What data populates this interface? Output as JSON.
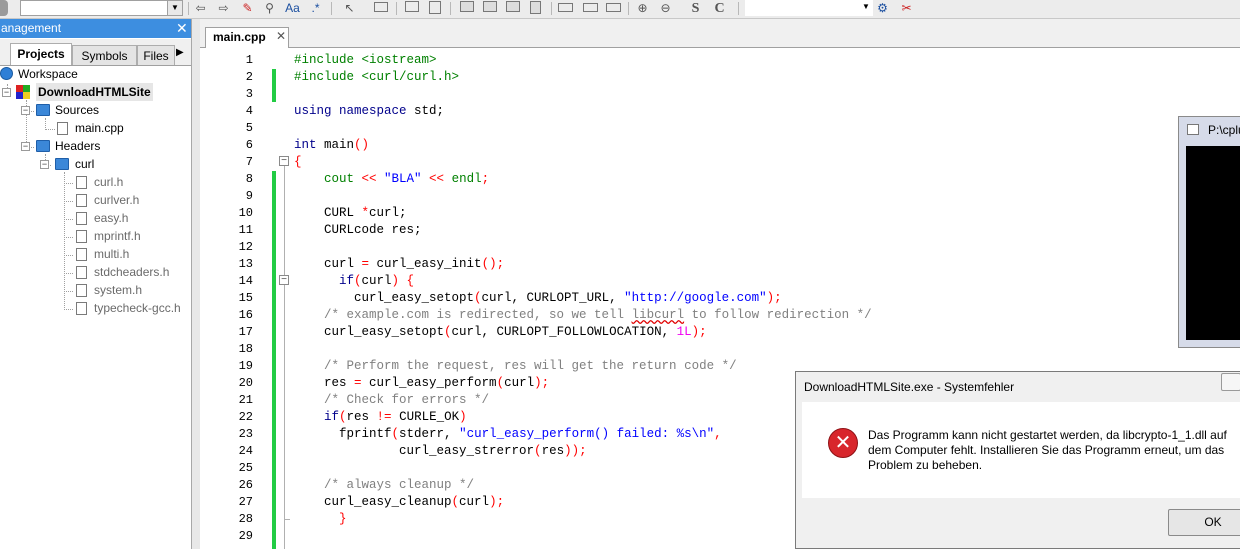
{
  "toolbar": {
    "icons": [
      "nav-back-icon",
      "nav-forward-icon",
      "highlight-icon",
      "bookmark-icon",
      "font-icon",
      "regex-icon",
      "select-icon",
      "frame-icon",
      "envelope-icon",
      "document-icon",
      "layout-icon",
      "zoom-in-icon",
      "zoom-out-icon",
      "spell-icon",
      "refresh-icon",
      "build-settings-icon",
      "tools-icon"
    ],
    "glyphs": {
      "back": "⇦",
      "forward": "⇨",
      "highlight": "✎",
      "bookmark": "⚲",
      "font": "Aa",
      "regex": ".*",
      "select": "↖",
      "zoomin": "⊕",
      "zoomout": "⊖",
      "s": "S",
      "c": "C",
      "settings": "⚙",
      "tools": "✂"
    }
  },
  "management": {
    "title": "anagement",
    "close": "✕",
    "tabs": [
      {
        "label": "Projects",
        "active": true
      },
      {
        "label": "Symbols",
        "active": false
      },
      {
        "label": "Files",
        "active": false
      }
    ],
    "tab_arrow": "▶",
    "tree": {
      "workspace": "Workspace",
      "project": "DownloadHTMLSite",
      "sources": "Sources",
      "main_file": "main.cpp",
      "headers": "Headers",
      "curl_folder": "curl",
      "headers_files": [
        "curl.h",
        "curlver.h",
        "easy.h",
        "mprintf.h",
        "multi.h",
        "stdcheaders.h",
        "system.h",
        "typecheck-gcc.h"
      ]
    }
  },
  "editor": {
    "tab_label": "main.cpp",
    "tab_close": "✕",
    "line_numbers": [
      "1",
      "2",
      "3",
      "4",
      "5",
      "6",
      "7",
      "8",
      "9",
      "10",
      "11",
      "12",
      "13",
      "14",
      "15",
      "16",
      "17",
      "18",
      "19",
      "20",
      "21",
      "22",
      "23",
      "24",
      "25",
      "26",
      "27",
      "28",
      "29"
    ],
    "code": {
      "l1": "#include <iostream>",
      "l2": "#include <curl/curl.h>",
      "l4a": "using namespace",
      "l4b": " std;",
      "l6a": "int",
      "l6b": " main",
      "l6c": "()",
      "l7": "{",
      "l8a": "    cout",
      "l8b": " << ",
      "l8c": "\"BLA\"",
      "l8d": " << ",
      "l8e": "endl",
      "l8f": ";",
      "l10a": "    CURL ",
      "l10b": "*",
      "l10c": "curl;",
      "l11": "    CURLcode res;",
      "l13a": "    curl ",
      "l13b": "=",
      "l13c": " curl_easy_init",
      "l13d": "();",
      "l14a": "      if",
      "l14b": "(",
      "l14c": "curl",
      "l14d": ") {",
      "l15a": "        curl_easy_setopt",
      "l15b": "(",
      "l15c": "curl, CURLOPT_URL, ",
      "l15d": "\"http://google.com\"",
      "l15e": ");",
      "l16a": "    /* example.com is redirected, so we tell ",
      "l16b": "libcurl",
      "l16c": " to follow redirection */",
      "l17a": "    curl_easy_setopt",
      "l17b": "(",
      "l17c": "curl, CURLOPT_FOLLOWLOCATION, ",
      "l17d": "1L",
      "l17e": ");",
      "l19": "    /* Perform the request, res will get the return code */",
      "l20a": "    res ",
      "l20b": "=",
      "l20c": " curl_easy_perform",
      "l20d": "(",
      "l20e": "curl",
      "l20f": ");",
      "l21": "    /* Check for errors */",
      "l22a": "    if",
      "l22b": "(",
      "l22c": "res ",
      "l22d": "!=",
      "l22e": " CURLE_OK",
      "l22f": ")",
      "l23a": "      fprintf",
      "l23b": "(",
      "l23c": "stderr, ",
      "l23d": "\"curl_easy_perform() failed: %s\\n\"",
      "l23e": ",",
      "l24a": "              curl_easy_strerror",
      "l24b": "(",
      "l24c": "res",
      "l24d": "));",
      "l26": "    /* always cleanup */",
      "l27a": "    curl_easy_cleanup",
      "l27b": "(",
      "l27c": "curl",
      "l27d": ");",
      "l28": "      }"
    }
  },
  "console": {
    "title": "P:\\cplu"
  },
  "dialog": {
    "title": "DownloadHTMLSite.exe - Systemfehler",
    "icon": "✕",
    "message": "Das Programm kann nicht gestartet werden, da libcrypto-1_1.dll auf dem Computer fehlt. Installieren Sie das Programm erneut, um das Problem zu beheben.",
    "ok_label": "OK"
  },
  "colors": {
    "title_bar_blue": "#3d8ee0",
    "change_bar_green": "#22cc44",
    "error_red": "#d8262c"
  }
}
